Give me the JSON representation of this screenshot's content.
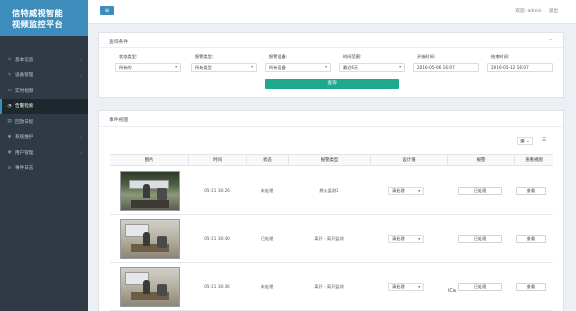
{
  "app": {
    "logo_line1": "信特威视智能",
    "logo_line2": "视频监控平台"
  },
  "sidebar": {
    "items": [
      {
        "label": "基本信息",
        "icon": "home-icon",
        "chevron": "‹"
      },
      {
        "label": "设备管理",
        "icon": "wrench-icon",
        "chevron": "‹"
      },
      {
        "label": "实时视频",
        "icon": "video-icon",
        "chevron": ""
      },
      {
        "label": "告警检索",
        "icon": "bell-icon",
        "chevron": "",
        "active": true
      },
      {
        "label": "回放日程",
        "icon": "calendar-icon",
        "chevron": ""
      },
      {
        "label": "系统维护",
        "icon": "gear-icon",
        "chevron": "‹"
      },
      {
        "label": "用户管理",
        "icon": "users-icon",
        "chevron": "‹"
      },
      {
        "label": "事件日志",
        "icon": "log-icon",
        "chevron": ""
      }
    ]
  },
  "header": {
    "toggle_icon": "≡",
    "user_text": "欢迎: admin",
    "logout_label": "退出"
  },
  "query": {
    "title": "查询条件",
    "collapse_icon": "−",
    "fields": [
      {
        "label": "状态类型:",
        "value": "所有的",
        "dropdown": true
      },
      {
        "label": "报警类型:",
        "value": "所有类型",
        "dropdown": true
      },
      {
        "label": "报警设备:",
        "value": "所有设备",
        "dropdown": true
      },
      {
        "label": "时间范围:",
        "value": "最近6天",
        "dropdown": true
      },
      {
        "label": "开始时间:",
        "value": "2016-05-06 16:07",
        "dropdown": false
      },
      {
        "label": "结束时间:",
        "value": "2016-05-12 16:07",
        "dropdown": false
      }
    ],
    "button_label": "查询"
  },
  "results": {
    "title": "事件视图",
    "view_toggle": "▦ ⌄",
    "columns_icon": "☰",
    "columns": [
      "图片",
      "时间",
      "状态",
      "报警类型",
      "设计值",
      "报警",
      "查看视图"
    ],
    "rows": [
      {
        "time": "05-11 16:26",
        "status": "未处理",
        "type": "燃火监测1",
        "select": "请处理",
        "alarm": "已处理",
        "view": "查看"
      },
      {
        "time": "05-11 16:40",
        "status": "已处理",
        "type": "离开 - 离开监测",
        "select": "请处理",
        "alarm": "已处理",
        "view": "查看"
      },
      {
        "time": "05-11 16:36",
        "status": "未处理",
        "type": "离开 - 离开监测",
        "select": "请处理",
        "alarm": "已处理",
        "view": "查看"
      }
    ],
    "watermark": "iCa"
  }
}
